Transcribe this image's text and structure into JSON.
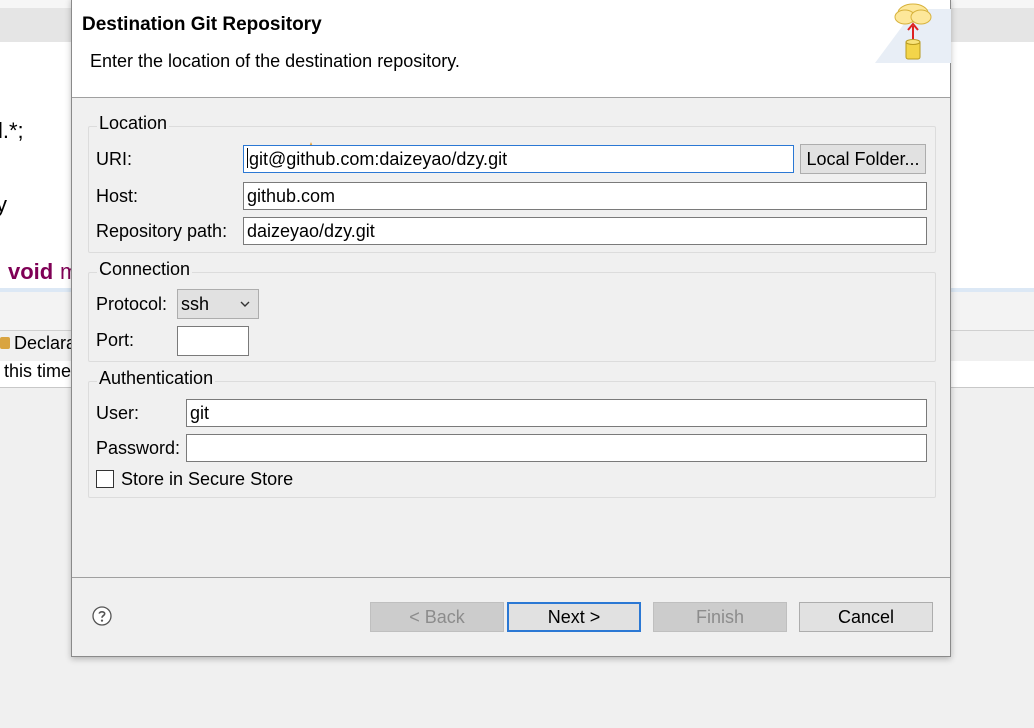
{
  "background": {
    "code_line_1": "l.*;",
    "code_line_2": "y",
    "code_keyword": "void",
    "code_after_keyword": "m",
    "view_tab_label": "Declara",
    "view_text": "this time"
  },
  "dialog": {
    "title": "Destination Git Repository",
    "description": "Enter the location of the destination repository.",
    "location": {
      "legend": "Location",
      "uri_label": "URI:",
      "uri_value": "git@github.com:daizeyao/dzy.git",
      "local_folder_button": "Local Folder...",
      "host_label": "Host:",
      "host_value": "github.com",
      "repo_path_label": "Repository path:",
      "repo_path_value": "daizeyao/dzy.git"
    },
    "connection": {
      "legend": "Connection",
      "protocol_label": "Protocol:",
      "protocol_value": "ssh",
      "port_label": "Port:",
      "port_value": ""
    },
    "authentication": {
      "legend": "Authentication",
      "user_label": "User:",
      "user_value": "git",
      "password_label": "Password:",
      "password_value": "",
      "store_label": "Store in Secure Store",
      "store_checked": false
    },
    "buttons": {
      "back": "< Back",
      "next": "Next >",
      "finish": "Finish",
      "cancel": "Cancel"
    }
  },
  "colors": {
    "accent": "#2b78d4",
    "keyword": "#7f0055",
    "dialog_bg": "#f0f0f0"
  },
  "icons": [
    "wizard-git-push-icon",
    "content-assist-icon",
    "chevron-down-icon",
    "help-icon",
    "declaration-tab-icon"
  ]
}
